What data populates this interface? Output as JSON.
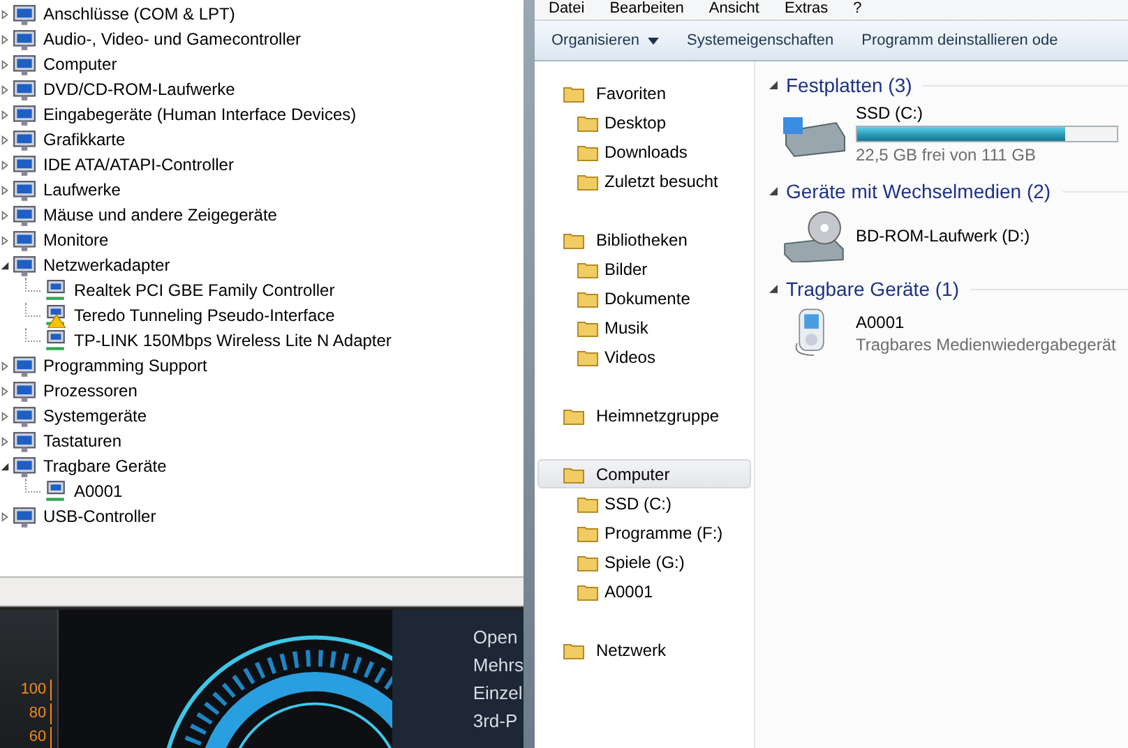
{
  "device_manager": {
    "tree": [
      {
        "label": "Anschlüsse (COM & LPT)",
        "expanded": false
      },
      {
        "label": "Audio-, Video- und Gamecontroller",
        "expanded": false
      },
      {
        "label": "Computer",
        "expanded": false
      },
      {
        "label": "DVD/CD-ROM-Laufwerke",
        "expanded": false
      },
      {
        "label": "Eingabegeräte (Human Interface Devices)",
        "expanded": false
      },
      {
        "label": "Grafikkarte",
        "expanded": false
      },
      {
        "label": "IDE ATA/ATAPI-Controller",
        "expanded": false
      },
      {
        "label": "Laufwerke",
        "expanded": false
      },
      {
        "label": "Mäuse und andere Zeigegeräte",
        "expanded": false
      },
      {
        "label": "Monitore",
        "expanded": false
      },
      {
        "label": "Netzwerkadapter",
        "expanded": true,
        "children": [
          {
            "label": "Realtek PCI GBE Family Controller",
            "warning": false
          },
          {
            "label": "Teredo Tunneling Pseudo-Interface",
            "warning": true
          },
          {
            "label": "TP-LINK 150Mbps Wireless Lite N Adapter",
            "warning": false
          }
        ]
      },
      {
        "label": "Programming Support",
        "expanded": false
      },
      {
        "label": "Prozessoren",
        "expanded": false
      },
      {
        "label": "Systemgeräte",
        "expanded": false
      },
      {
        "label": "Tastaturen",
        "expanded": false
      },
      {
        "label": "Tragbare Geräte",
        "expanded": true,
        "children": [
          {
            "label": "A0001",
            "warning": false
          }
        ]
      },
      {
        "label": "USB-Controller",
        "expanded": false
      }
    ]
  },
  "background_app": {
    "scale": [
      "100",
      "80",
      "60"
    ],
    "menu": [
      "Open",
      "Mehrs",
      "Einzel",
      "3rd-P"
    ]
  },
  "explorer": {
    "menu": [
      "Datei",
      "Bearbeiten",
      "Ansicht",
      "Extras",
      "?"
    ],
    "toolbar": [
      {
        "label": "Organisieren",
        "dropdown": true
      },
      {
        "label": "Systemeigenschaften",
        "dropdown": false
      },
      {
        "label": "Programm deinstallieren ode",
        "dropdown": false
      }
    ],
    "nav": [
      {
        "label": "Favoriten",
        "selected": false,
        "children": [
          {
            "label": "Desktop"
          },
          {
            "label": "Downloads"
          },
          {
            "label": "Zuletzt besucht"
          }
        ]
      },
      {
        "label": "Bibliotheken",
        "selected": false,
        "children": [
          {
            "label": "Bilder"
          },
          {
            "label": "Dokumente"
          },
          {
            "label": "Musik"
          },
          {
            "label": "Videos"
          }
        ]
      },
      {
        "label": "Heimnetzgruppe",
        "selected": false
      },
      {
        "label": "Computer",
        "selected": true,
        "children": [
          {
            "label": "SSD (C:)"
          },
          {
            "label": "Programme (F:)"
          },
          {
            "label": "Spiele (G:)"
          },
          {
            "label": "A0001"
          }
        ]
      },
      {
        "label": "Netzwerk",
        "selected": false
      }
    ],
    "groups": [
      {
        "title": "Festplatten (3)",
        "items": [
          {
            "kind": "drive",
            "name": "SSD (C:)",
            "level": 0.8,
            "detail": "22,5 GB frei von 111 GB"
          }
        ]
      },
      {
        "title": "Geräte mit Wechselmedien (2)",
        "items": [
          {
            "kind": "disc",
            "name": "BD-ROM-Laufwerk (D:)"
          }
        ]
      },
      {
        "title": "Tragbare Geräte (1)",
        "items": [
          {
            "kind": "player",
            "name": "A0001",
            "detail": "Tragbares Medienwiedergabegerät"
          }
        ]
      }
    ]
  }
}
